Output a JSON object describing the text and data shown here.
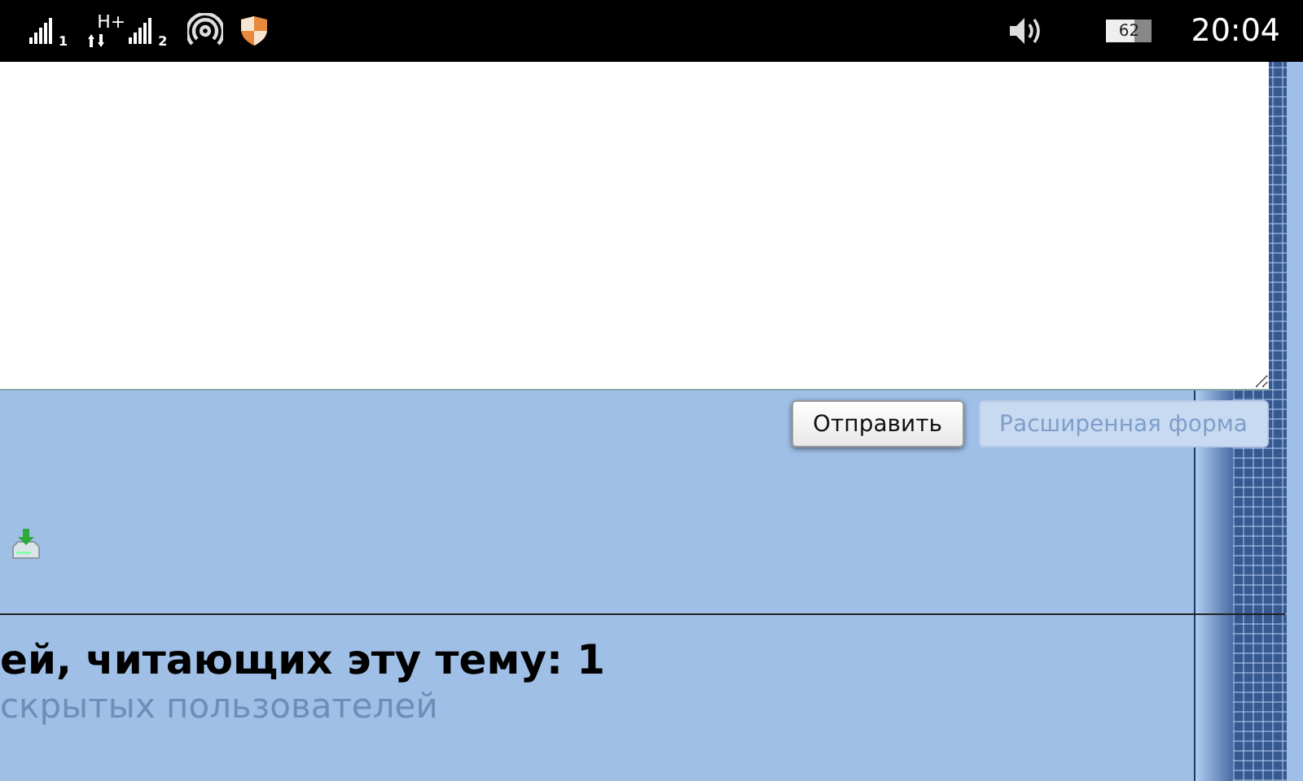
{
  "status_bar": {
    "sim_labels": [
      "1",
      "2"
    ],
    "network_type": "H+",
    "battery": "62",
    "time": "20:04"
  },
  "reply_form": {
    "buttons": [
      {
        "label": "Отправить",
        "disabled": false
      },
      {
        "label": "Расширенная форма",
        "disabled": true
      }
    ]
  },
  "viewers": {
    "heading": "ей, читающих эту тему: 1",
    "hidden_users": "скрытых пользователей"
  }
}
